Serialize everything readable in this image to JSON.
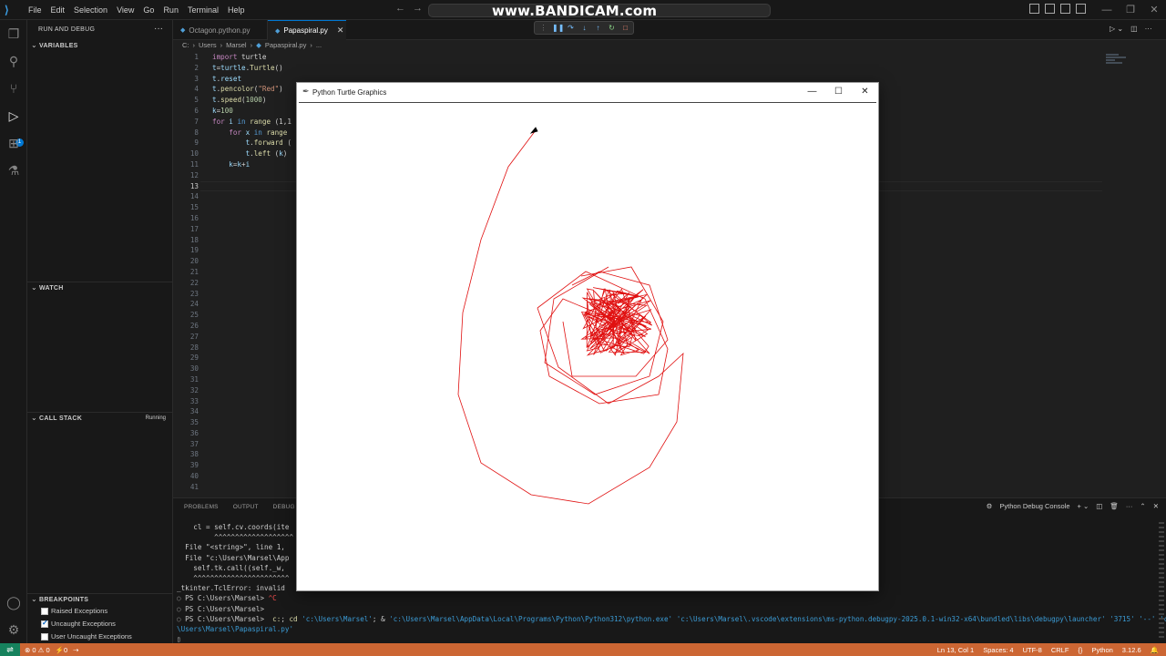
{
  "titlebar": {
    "menu": [
      "File",
      "Edit",
      "Selection",
      "View",
      "Go",
      "Run",
      "Terminal",
      "Help"
    ],
    "watermark": "www.BANDICAM.com"
  },
  "sidebar": {
    "title": "RUN AND DEBUG",
    "sections": {
      "variables": "VARIABLES",
      "watch": "WATCH",
      "call_stack": "CALL STACK",
      "call_stack_status": "Running",
      "breakpoints": "BREAKPOINTS"
    },
    "breakpoints": [
      {
        "label": "Raised Exceptions",
        "checked": false
      },
      {
        "label": "Uncaught Exceptions",
        "checked": true
      },
      {
        "label": "User Uncaught Exceptions",
        "checked": false
      }
    ],
    "activity_badge": "1"
  },
  "tabs": [
    {
      "label": "Octagon.python.py",
      "active": false
    },
    {
      "label": "Papaspiral.py",
      "active": true
    }
  ],
  "breadcrumb": [
    "C:",
    "Users",
    "Marsel",
    "Papaspiral.py",
    "..."
  ],
  "editor": {
    "line_count": 41,
    "current_line": 13,
    "lines": [
      [
        {
          "t": "import",
          "c": "kw"
        },
        {
          "t": " turtle",
          "c": "plain"
        }
      ],
      [
        {
          "t": "t",
          "c": "var"
        },
        {
          "t": "=",
          "c": "plain"
        },
        {
          "t": "turtle",
          "c": "var"
        },
        {
          "t": ".",
          "c": "plain"
        },
        {
          "t": "Turtle",
          "c": "fn"
        },
        {
          "t": "()",
          "c": "plain"
        }
      ],
      [
        {
          "t": "t",
          "c": "var"
        },
        {
          "t": ".",
          "c": "plain"
        },
        {
          "t": "reset",
          "c": "var"
        }
      ],
      [
        {
          "t": "t",
          "c": "var"
        },
        {
          "t": ".",
          "c": "plain"
        },
        {
          "t": "pencolor",
          "c": "fn"
        },
        {
          "t": "(",
          "c": "plain"
        },
        {
          "t": "\"Red\"",
          "c": "str"
        },
        {
          "t": ")",
          "c": "plain"
        }
      ],
      [
        {
          "t": "t",
          "c": "var"
        },
        {
          "t": ".",
          "c": "plain"
        },
        {
          "t": "speed",
          "c": "fn"
        },
        {
          "t": "(",
          "c": "plain"
        },
        {
          "t": "1000",
          "c": "num"
        },
        {
          "t": ")",
          "c": "plain"
        }
      ],
      [
        {
          "t": "k",
          "c": "var"
        },
        {
          "t": "=",
          "c": "plain"
        },
        {
          "t": "100",
          "c": "num"
        }
      ],
      [
        {
          "t": "for",
          "c": "kw"
        },
        {
          "t": " i ",
          "c": "var"
        },
        {
          "t": "in",
          "c": "kw2"
        },
        {
          "t": " range",
          "c": "fn"
        },
        {
          "t": " (1,1",
          "c": "plain"
        }
      ],
      [
        {
          "t": "    for",
          "c": "kw"
        },
        {
          "t": " x ",
          "c": "var"
        },
        {
          "t": "in",
          "c": "kw2"
        },
        {
          "t": " range",
          "c": "fn"
        }
      ],
      [
        {
          "t": "        t",
          "c": "var"
        },
        {
          "t": ".",
          "c": "plain"
        },
        {
          "t": "forward",
          "c": "fn"
        },
        {
          "t": " (",
          "c": "plain"
        }
      ],
      [
        {
          "t": "        t",
          "c": "var"
        },
        {
          "t": ".",
          "c": "plain"
        },
        {
          "t": "left",
          "c": "fn"
        },
        {
          "t": " (",
          "c": "plain"
        },
        {
          "t": "k",
          "c": "var"
        },
        {
          "t": ")",
          "c": "plain"
        }
      ],
      [
        {
          "t": "    k",
          "c": "var"
        },
        {
          "t": "=",
          "c": "plain"
        },
        {
          "t": "k",
          "c": "var"
        },
        {
          "t": "+",
          "c": "plain"
        },
        {
          "t": "i",
          "c": "var"
        }
      ],
      [],
      []
    ]
  },
  "panel": {
    "tabs": [
      "PROBLEMS",
      "OUTPUT",
      "DEBUG CO"
    ],
    "console_label": "Python Debug Console",
    "terminal_lines": [
      [
        {
          "t": "    cl = self.cv.coords(ite",
          "c": ""
        }
      ],
      [
        {
          "t": "         ^^^^^^^^^^^^^^^^^^^",
          "c": ""
        }
      ],
      [
        {
          "t": "  File \"<string>\", line 1,",
          "c": ""
        }
      ],
      [
        {
          "t": "  File \"c:\\Users\\Marsel\\App",
          "c": ""
        }
      ],
      [
        {
          "t": "    self.tk.call((self._w,",
          "c": ""
        }
      ],
      [
        {
          "t": "    ^^^^^^^^^^^^^^^^^^^^^^^",
          "c": ""
        }
      ],
      [
        {
          "t": "_tkinter.TclError: invalid",
          "c": ""
        }
      ],
      [
        {
          "t": "○ ",
          "c": "t-circle"
        },
        {
          "t": "PS C:\\Users\\Marsel> ",
          "c": ""
        },
        {
          "t": "^C",
          "c": "t-ctrl"
        }
      ],
      [
        {
          "t": "○ ",
          "c": "t-circle"
        },
        {
          "t": "PS C:\\Users\\Marsel>",
          "c": ""
        }
      ],
      [
        {
          "t": "○ ",
          "c": "t-circle"
        },
        {
          "t": "PS C:\\Users\\Marsel> ",
          "c": ""
        },
        {
          "t": " c:",
          "c": "t-yellow"
        },
        {
          "t": "; ",
          "c": ""
        },
        {
          "t": "cd",
          "c": "t-yellow"
        },
        {
          "t": " 'c:\\Users\\Marsel'",
          "c": "t-cyan"
        },
        {
          "t": "; & ",
          "c": ""
        },
        {
          "t": "'c:\\Users\\Marsel\\AppData\\Local\\Programs\\Python\\Python312\\python.exe'",
          "c": "t-cyan"
        },
        {
          "t": " ",
          "c": ""
        },
        {
          "t": "'c:\\Users\\Marsel\\.vscode\\extensions\\ms-python.debugpy-2025.0.1-win32-x64\\bundled\\libs\\debugpy\\launcher'",
          "c": "t-cyan"
        },
        {
          "t": " ",
          "c": ""
        },
        {
          "t": "'3715'",
          "c": "t-cyan"
        },
        {
          "t": " '--' ",
          "c": "t-cyan"
        },
        {
          "t": "'c:",
          "c": "t-cyan"
        }
      ],
      [
        {
          "t": "\\Users\\Marsel\\Papaspiral.py'",
          "c": "t-cyan"
        }
      ],
      [
        {
          "t": "▯",
          "c": ""
        }
      ]
    ]
  },
  "statusbar": {
    "errors": "0",
    "warnings": "0",
    "ports": "0",
    "position": "Ln 13, Col 1",
    "spaces": "Spaces: 4",
    "encoding": "UTF-8",
    "eol": "CRLF",
    "braces": "{}",
    "language": "Python",
    "version": "3.12.6"
  },
  "turtle_window": {
    "title": "Python Turtle Graphics",
    "pen_color": "#e01010"
  }
}
